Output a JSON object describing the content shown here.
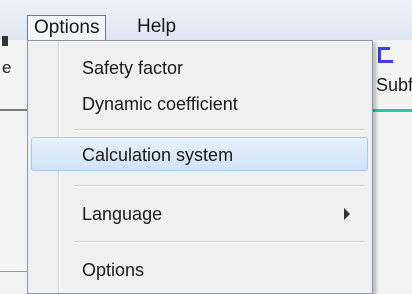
{
  "menubar": {
    "options_label": "Options",
    "help_label": "Help"
  },
  "background": {
    "left_letter": "e",
    "right_label": "Subf"
  },
  "dropdown": {
    "items": [
      {
        "label": "Safety factor"
      },
      {
        "label": "Dynamic coefficient"
      },
      {
        "label": "Calculation system",
        "highlighted": true
      },
      {
        "label": "Language",
        "submenu": true
      },
      {
        "label": "Options"
      }
    ]
  },
  "colors": {
    "highlight": "#cfe3f7",
    "accent_blue": "#3a3df0",
    "accent_teal": "#27c7a8"
  }
}
